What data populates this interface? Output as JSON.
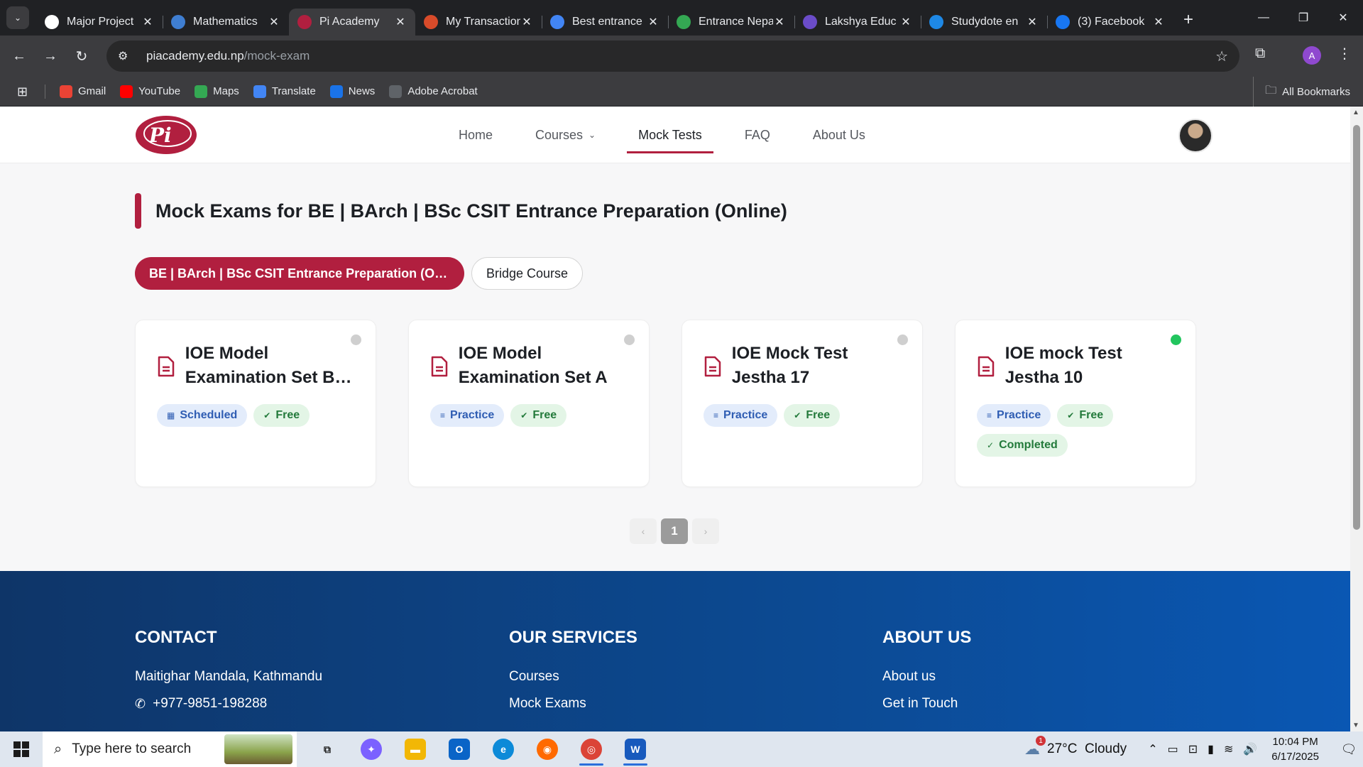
{
  "browser": {
    "tabs": [
      {
        "title": "Major Project",
        "icon": "openai-icon",
        "color": "#ffffff"
      },
      {
        "title": "Mathematics",
        "icon": "mountain-icon",
        "color": "#3f7ed1"
      },
      {
        "title": "Pi Academy",
        "icon": "pi-academy-icon",
        "color": "#b11f3f",
        "active": true
      },
      {
        "title": "My Transactions",
        "icon": "bank-icon",
        "color": "#d84b2a"
      },
      {
        "title": "Best entrance",
        "icon": "google-icon",
        "color": "#4285f4"
      },
      {
        "title": "Entrance Nepal",
        "icon": "play-icon",
        "color": "#34a853"
      },
      {
        "title": "Lakshya Educ",
        "icon": "lakshya-icon",
        "color": "#6b4cc9"
      },
      {
        "title": "Studydote en",
        "icon": "studydote-icon",
        "color": "#1e88e5"
      },
      {
        "title": "(3) Facebook",
        "icon": "facebook-icon",
        "color": "#1877f2"
      }
    ],
    "url_host": "piacademy.edu.np",
    "url_path": "/mock-exam",
    "profile_initial": "A",
    "bookmarks": [
      {
        "label": "Gmail",
        "icon": "gmail-icon",
        "color": "#ea4335"
      },
      {
        "label": "YouTube",
        "icon": "youtube-icon",
        "color": "#ff0000"
      },
      {
        "label": "Maps",
        "icon": "maps-icon",
        "color": "#34a853"
      },
      {
        "label": "Translate",
        "icon": "translate-icon",
        "color": "#4285f4"
      },
      {
        "label": "News",
        "icon": "news-icon",
        "color": "#1a73e8"
      },
      {
        "label": "Adobe Acrobat",
        "icon": "globe-icon",
        "color": "#5f6368"
      }
    ],
    "all_bookmarks": "All Bookmarks"
  },
  "site": {
    "logo_text": "Pi",
    "nav": [
      {
        "label": "Home"
      },
      {
        "label": "Courses",
        "dropdown": true
      },
      {
        "label": "Mock Tests",
        "active": true
      },
      {
        "label": "FAQ"
      },
      {
        "label": "About Us"
      }
    ],
    "accent_color": "#b11f3f"
  },
  "main": {
    "title": "Mock Exams for BE | BArch | BSc CSIT Entrance Preparation (Online)",
    "filters": [
      {
        "label": "BE | BArch | BSc CSIT Entrance Preparation (Online)",
        "active": true
      },
      {
        "label": "Bridge Course",
        "active": false
      }
    ],
    "cards": [
      {
        "title": "IOE Model Examination Set B (Practice)",
        "status": "inactive",
        "badges": [
          {
            "label": "Scheduled",
            "kind": "blue",
            "icon": "calendar-icon"
          },
          {
            "label": "Free",
            "kind": "green",
            "icon": "check-circle-icon"
          }
        ]
      },
      {
        "title": "IOE Model Examination Set A",
        "status": "inactive",
        "badges": [
          {
            "label": "Practice",
            "kind": "blue",
            "icon": "list-icon"
          },
          {
            "label": "Free",
            "kind": "green",
            "icon": "check-circle-icon"
          }
        ]
      },
      {
        "title": "IOE Mock Test Jestha 17",
        "status": "inactive",
        "badges": [
          {
            "label": "Practice",
            "kind": "blue",
            "icon": "list-icon"
          },
          {
            "label": "Free",
            "kind": "green",
            "icon": "check-circle-icon"
          }
        ]
      },
      {
        "title": "IOE mock Test Jestha 10",
        "status": "live",
        "badges": [
          {
            "label": "Practice",
            "kind": "blue",
            "icon": "list-icon"
          },
          {
            "label": "Free",
            "kind": "green",
            "icon": "check-circle-icon"
          },
          {
            "label": "Completed",
            "kind": "green",
            "icon": "check-icon"
          }
        ]
      }
    ],
    "pagination": {
      "prev": "‹",
      "current": "1",
      "next": "›"
    }
  },
  "footer": {
    "contact": {
      "heading": "CONTACT",
      "address": "Maitighar Mandala, Kathmandu",
      "phone": "+977-9851-198288"
    },
    "services": {
      "heading": "OUR SERVICES",
      "links": [
        "Courses",
        "Mock Exams"
      ]
    },
    "about": {
      "heading": "ABOUT US",
      "links": [
        "About us",
        "Get in Touch"
      ]
    }
  },
  "taskbar": {
    "search_placeholder": "Type here to search",
    "apps": [
      {
        "name": "task-view",
        "color": "#dfe6ef"
      },
      {
        "name": "copilot",
        "color": "#7b61ff"
      },
      {
        "name": "file-explorer",
        "color": "#f2b705"
      },
      {
        "name": "outlook",
        "color": "#0a64c7"
      },
      {
        "name": "edge",
        "color": "#0c8ad8"
      },
      {
        "name": "firefox",
        "color": "#ff6a00"
      },
      {
        "name": "chrome",
        "color": "#db4437",
        "open": true
      },
      {
        "name": "word",
        "color": "#185abd",
        "open": true
      }
    ],
    "weather": {
      "temp": "27°C",
      "condition": "Cloudy",
      "alerts": "1"
    },
    "time": "10:04 PM",
    "date": "6/17/2025"
  }
}
